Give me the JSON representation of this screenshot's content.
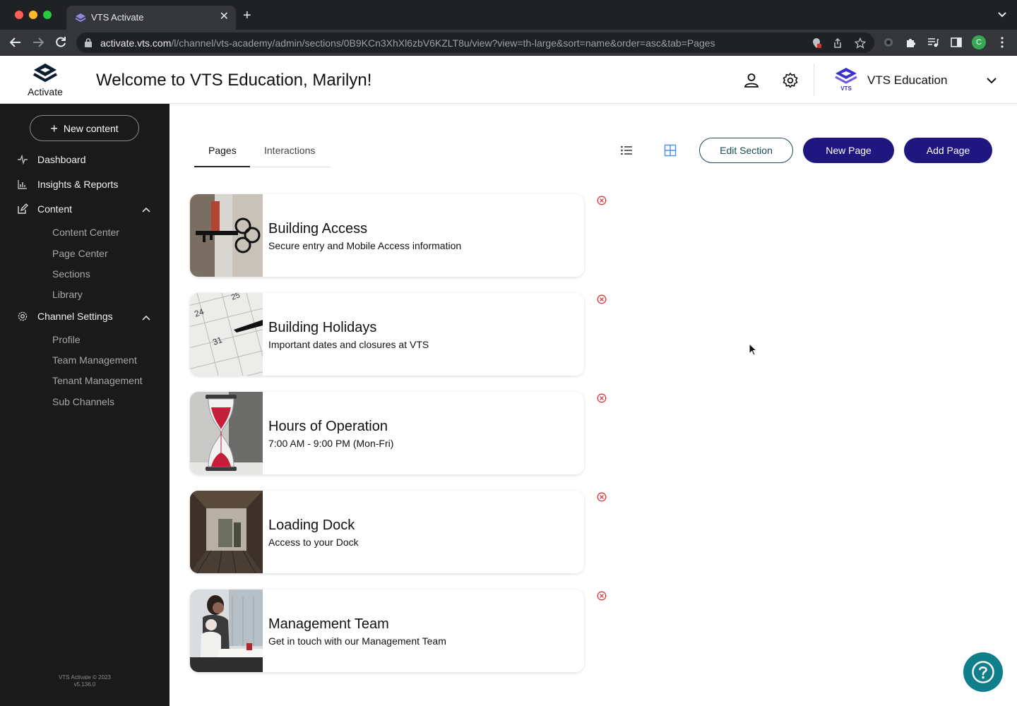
{
  "browser": {
    "tab_title": "VTS Activate",
    "tab_close": "✕",
    "new_tab": "+",
    "url_host": "activate.vts.com",
    "url_path": "/l/channel/vts-academy/admin/sections/0B9KCn3XhXl6zbV6KZLT8u/view?view=th-large&sort=name&order=asc&tab=Pages",
    "profile_initial": "C"
  },
  "header": {
    "logo_text": "Activate",
    "welcome": "Welcome to VTS Education, Marilyn!",
    "org_name": "VTS Education"
  },
  "sidebar": {
    "new_content": "New content",
    "new_content_icon": "+",
    "dashboard": "Dashboard",
    "insights": "Insights & Reports",
    "content": "Content",
    "content_items": [
      "Content Center",
      "Page Center",
      "Sections",
      "Library"
    ],
    "channel_settings": "Channel Settings",
    "channel_items": [
      "Profile",
      "Team Management",
      "Tenant Management",
      "Sub Channels"
    ],
    "footer_line1": "VTS Activate © 2023",
    "footer_line2": "v5.136.0"
  },
  "main": {
    "tabs": [
      "Pages",
      "Interactions"
    ],
    "active_tab": "Pages",
    "view_mode": "grid",
    "buttons": {
      "edit_section": "Edit Section",
      "new_page": "New Page",
      "add_page": "Add Page"
    },
    "pages": [
      {
        "title": "Building Access",
        "subtitle": "Secure entry and Mobile Access information",
        "thumb": "key-photo"
      },
      {
        "title": "Building Holidays",
        "subtitle": "Important dates and closures at VTS",
        "thumb": "calendar-photo"
      },
      {
        "title": "Hours of Operation",
        "subtitle": "7:00 AM - 9:00 PM (Mon-Fri)",
        "thumb": "hourglass-photo"
      },
      {
        "title": "Loading Dock",
        "subtitle": "Access to your Dock",
        "thumb": "loading-dock-photo"
      },
      {
        "title": "Management Team",
        "subtitle": "Get in touch with our Management Team",
        "thumb": "team-photo"
      }
    ]
  },
  "colors": {
    "primary": "#1f1680",
    "sidebar_bg": "#1a1a1a",
    "help_bg": "#0f7f8c",
    "remove_icon": "#d9383d"
  }
}
